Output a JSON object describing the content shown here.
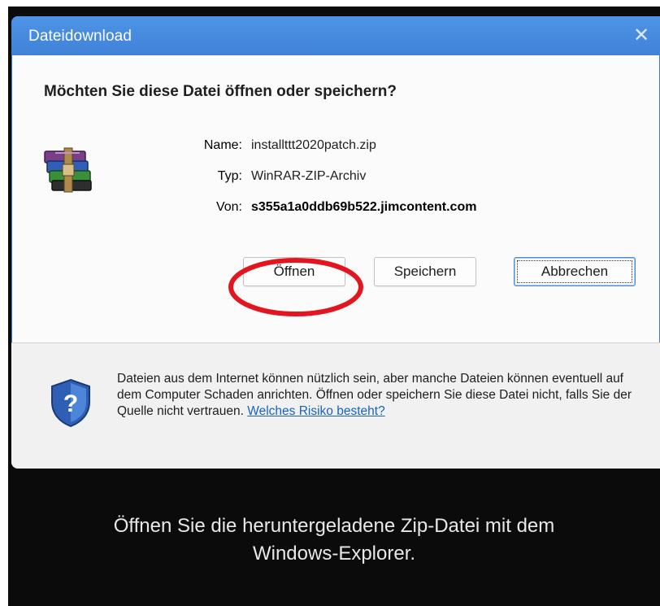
{
  "dialog": {
    "title": "Dateidownload",
    "close_symbol": "✕",
    "question": "Möchten Sie diese Datei öffnen oder speichern?",
    "file": {
      "name_label": "Name:",
      "name_value": "installttt2020patch.zip",
      "type_label": "Typ:",
      "type_value": "WinRAR-ZIP-Archiv",
      "from_label": "Von:",
      "from_value": "s355a1a0ddb69b522.jimcontent.com",
      "icon": "winrar-archive-icon"
    },
    "buttons": {
      "open": "Öffnen",
      "save": "Speichern",
      "cancel": "Abbrechen"
    },
    "warning": {
      "icon": "shield-question-icon",
      "text": "Dateien aus dem Internet können nützlich sein, aber manche Dateien können eventuell auf dem Computer Schaden anrichten. Öffnen oder speichern Sie diese Datei nicht, falls Sie der Quelle nicht vertrauen.",
      "link": "Welches Risiko besteht?"
    }
  },
  "annotation": {
    "highlight_color": "#e3161f",
    "caption_line1": "Öffnen Sie die heruntergeladene Zip-Datei mit dem",
    "caption_line2": "Windows-Explorer."
  },
  "colors": {
    "titlebar": "#4a8de0",
    "link": "#1a5fc5",
    "background": "#0b0b0b"
  }
}
